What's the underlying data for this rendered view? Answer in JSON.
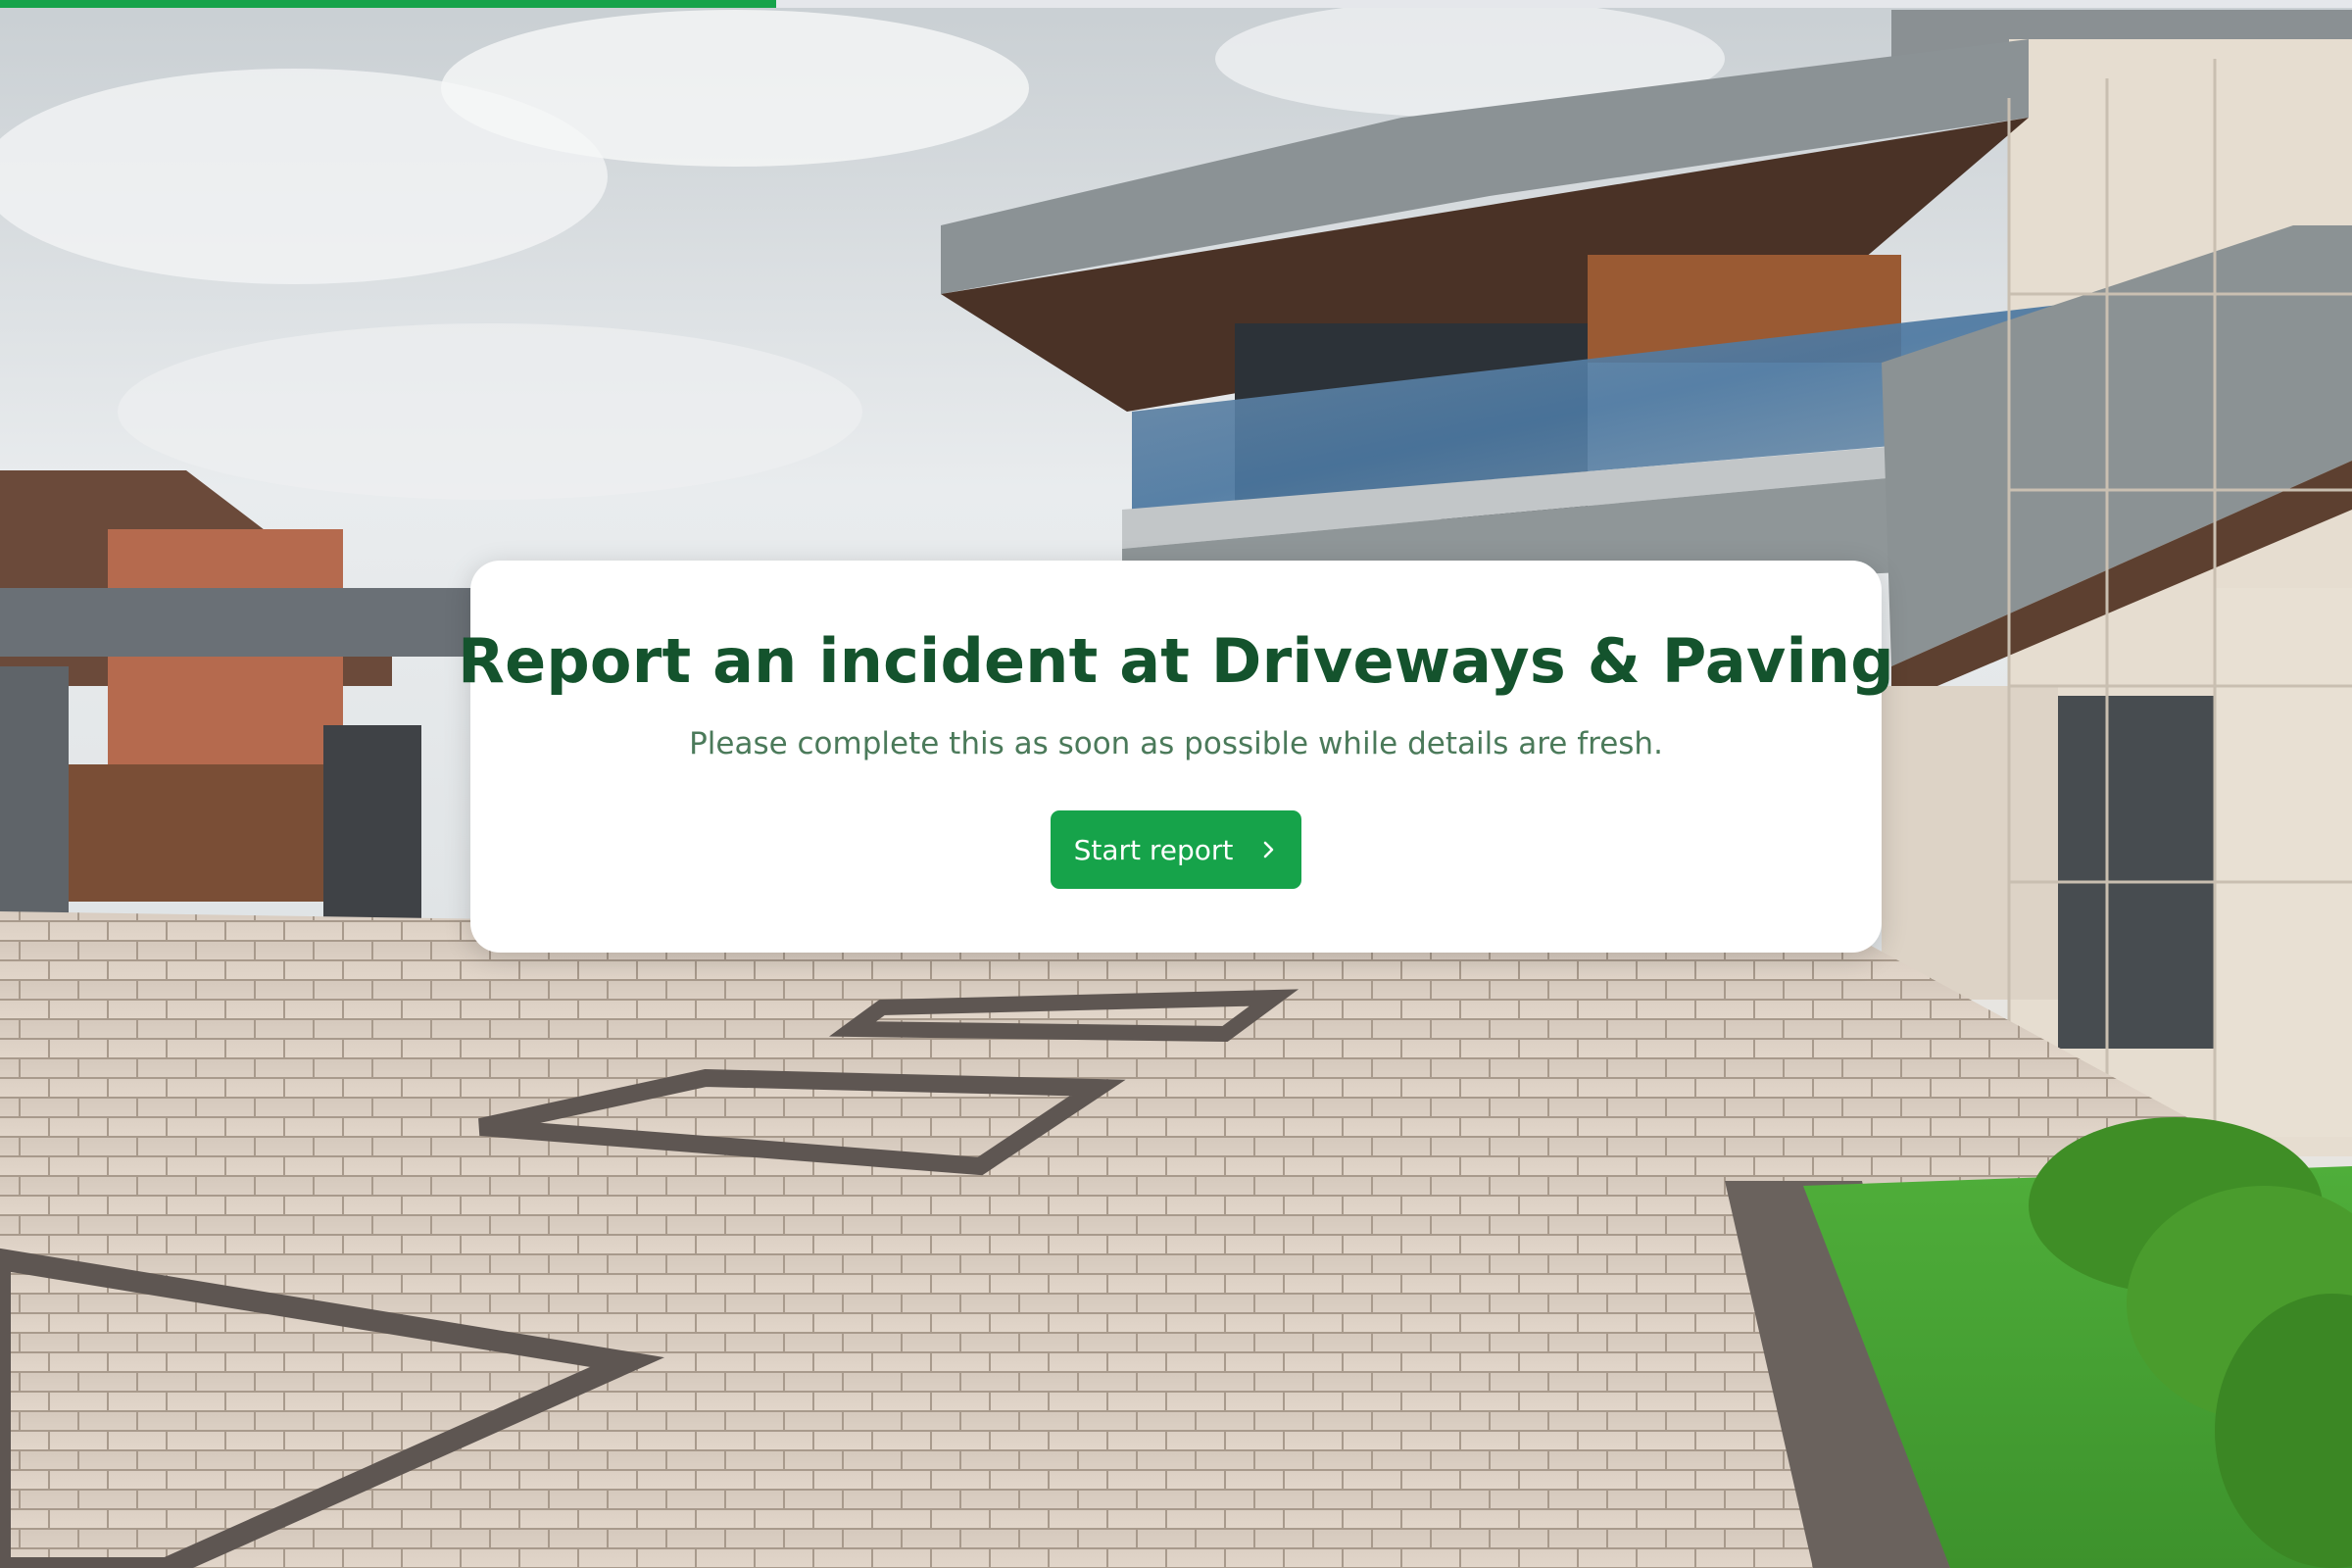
{
  "progress": {
    "value": 0.33,
    "color": "#16a34a"
  },
  "card": {
    "title": "Report an incident at Driveways & Paving",
    "subtitle": "Please complete this as soon as possible while details are fresh.",
    "start_button": {
      "label": "Start report",
      "icon": "chevron-right-icon"
    }
  },
  "colors": {
    "accent": "#16a34a",
    "title": "#14532d",
    "subtitle": "#4b7a5a",
    "card_background": "#ffffff"
  },
  "background": {
    "icon": "house-driveway-photo"
  }
}
